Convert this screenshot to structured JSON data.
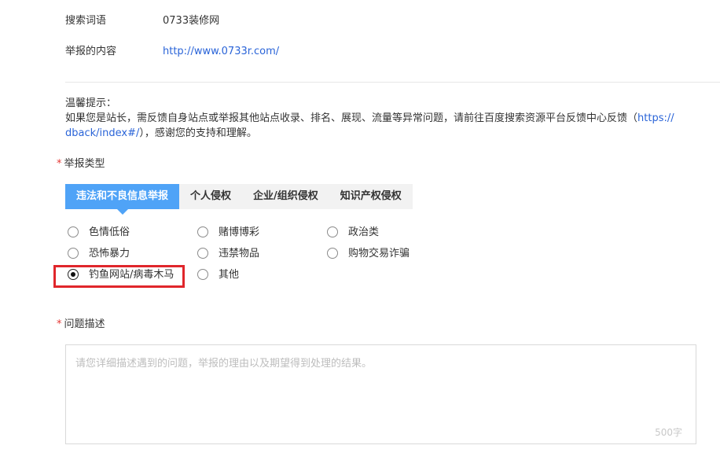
{
  "info": {
    "keyword_label": "搜索词语",
    "keyword_value": "0733装修网",
    "content_label": "举报的内容",
    "content_url": "http://www.0733r.com/"
  },
  "tip": {
    "title": "温馨提示：",
    "line1": "如果您是站长，需反馈自身站点或举报其他站点收录、排名、展现、流量等异常问题，请前往百度搜索资源平台反馈中心反馈（",
    "line1_url": "https://",
    "line2_url": "dback/index#/",
    "line2_rest": "），感谢您的支持和理解。"
  },
  "report_type": {
    "label": "举报类型",
    "tabs": [
      {
        "label": "违法和不良信息举报",
        "active": true
      },
      {
        "label": "个人侵权",
        "active": false
      },
      {
        "label": "企业/组织侵权",
        "active": false
      },
      {
        "label": "知识产权侵权",
        "active": false
      }
    ],
    "options": [
      {
        "label": "色情低俗",
        "checked": false
      },
      {
        "label": "赌博博彩",
        "checked": false
      },
      {
        "label": "政治类",
        "checked": false
      },
      {
        "label": "恐怖暴力",
        "checked": false
      },
      {
        "label": "违禁物品",
        "checked": false
      },
      {
        "label": "购物交易诈骗",
        "checked": false
      },
      {
        "label": "钓鱼网站/病毒木马",
        "checked": true
      },
      {
        "label": "其他",
        "checked": false
      }
    ]
  },
  "description": {
    "label": "问题描述",
    "placeholder": "请您详细描述遇到的问题，举报的理由以及期望得到处理的结果。",
    "counter": "500字"
  },
  "colors": {
    "accent": "#4fa3f7",
    "link": "#2a64d8",
    "required": "#e53935",
    "highlight": "#e0262b"
  }
}
